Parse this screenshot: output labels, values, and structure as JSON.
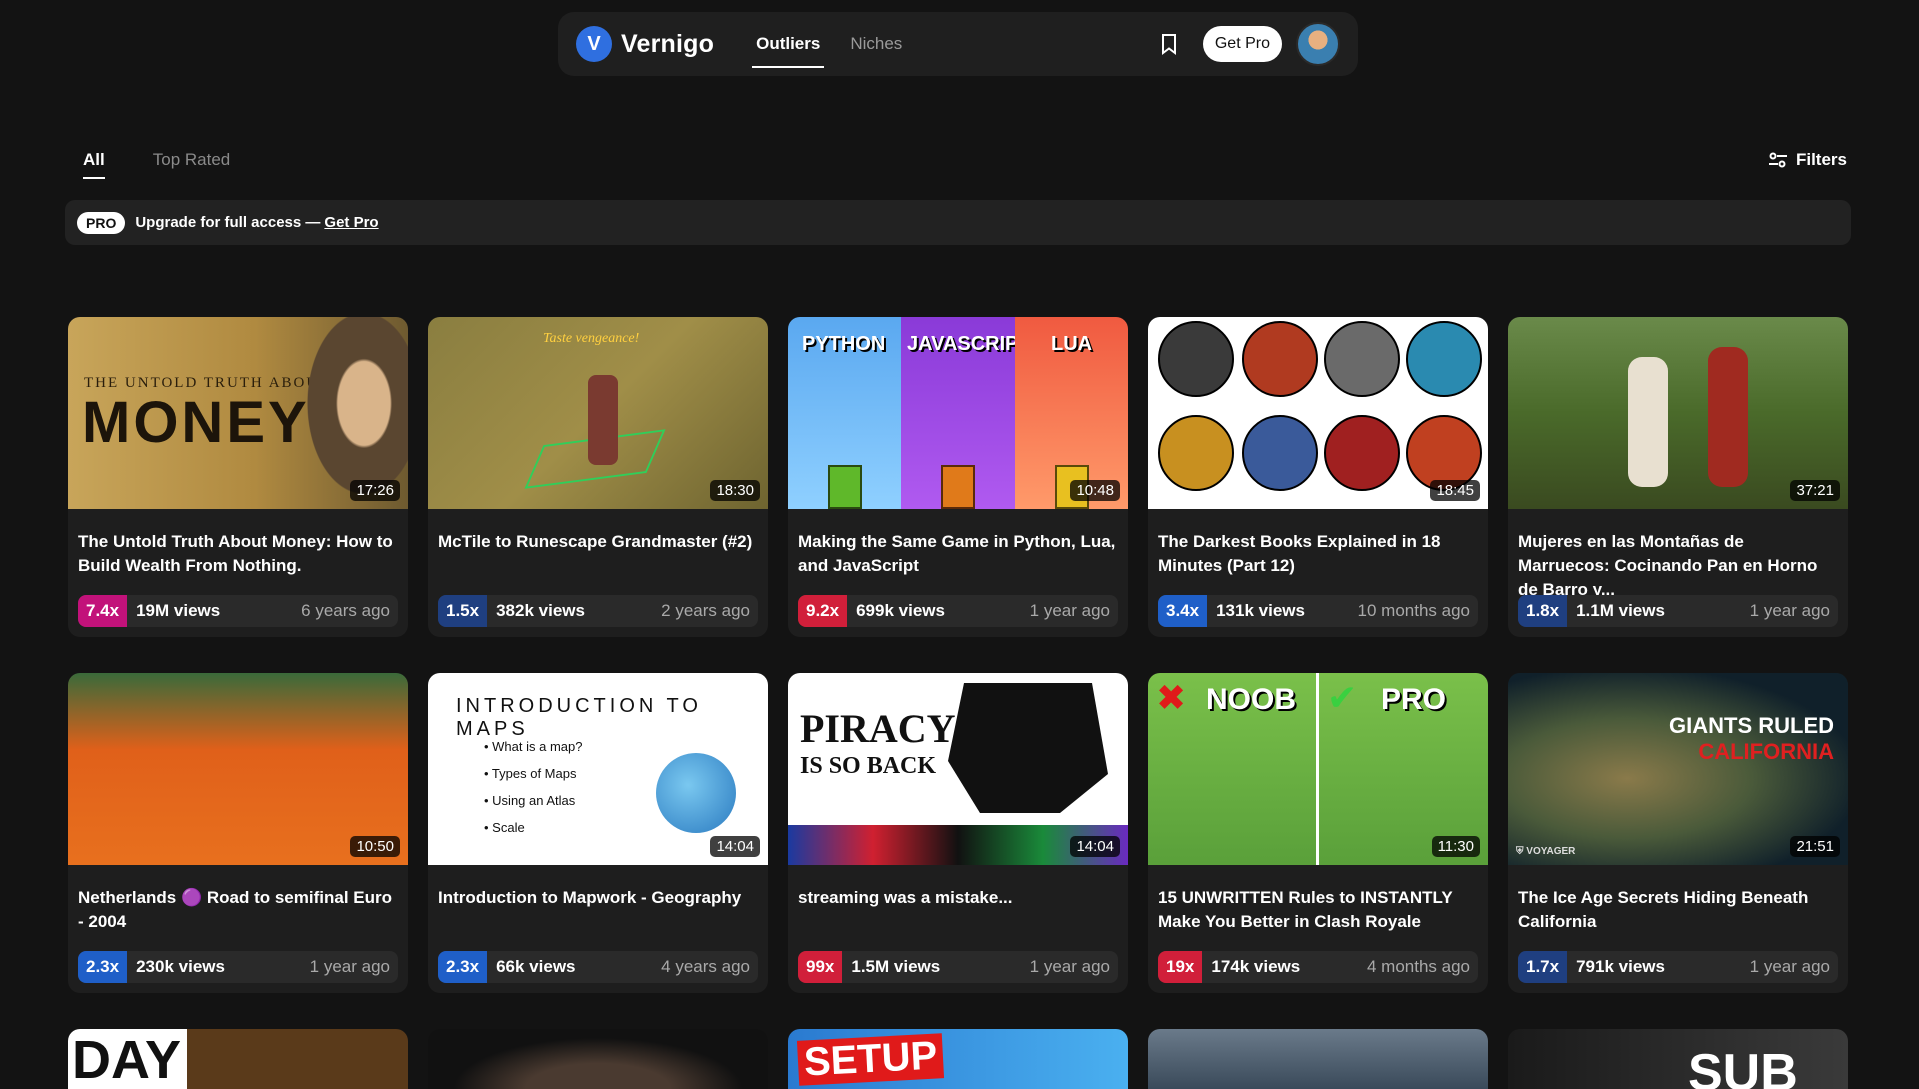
{
  "nav": {
    "logo_letter": "V",
    "brand": "Vernigo",
    "links": [
      {
        "label": "Outliers"
      },
      {
        "label": "Niches"
      }
    ],
    "get_pro": "Get Pro"
  },
  "tabs": [
    {
      "label": "All"
    },
    {
      "label": "Top Rated"
    }
  ],
  "filters_label": "Filters",
  "banner": {
    "badge": "PRO",
    "text": "Upgrade for full access —",
    "link": "Get Pro"
  },
  "colors": {
    "red": "#d11f3a",
    "blue": "#1f5fc8",
    "magenta": "#c2127a"
  },
  "videos": [
    {
      "title": "The Untold Truth About Money: How to Build Wealth From Nothing.",
      "duration": "17:26",
      "multiplier": "7.4x",
      "views": "19M views",
      "age": "6 years ago",
      "mult_color": "#c2127a",
      "thumb_text": "THE UNTOLD TRUTH ABOUT",
      "thumb_big": "MONEY"
    },
    {
      "title": "McTile to Runescape Grandmaster (#2)",
      "duration": "18:30",
      "multiplier": "1.5x",
      "views": "382k views",
      "age": "2 years ago",
      "mult_color": "#1f3f80",
      "thumb_text": "Taste vengeance!",
      "thumb_big": ""
    },
    {
      "title": "Making the Same Game in Python, Lua, and JavaScript",
      "duration": "10:48",
      "multiplier": "9.2x",
      "views": "699k views",
      "age": "1 year ago",
      "mult_color": "#d11f3a",
      "thumb_text": "PYTHON",
      "thumb_big": "JAVASCRIPT|LUA"
    },
    {
      "title": "The Darkest Books Explained in 18 Minutes (Part 12)",
      "duration": "18:45",
      "multiplier": "3.4x",
      "views": "131k views",
      "age": "10 months ago",
      "mult_color": "#1f5fc8",
      "thumb_text": "",
      "thumb_big": ""
    },
    {
      "title": "Mujeres en las Montañas de Marruecos: Cocinando Pan en Horno de Barro y...",
      "duration": "37:21",
      "multiplier": "1.8x",
      "views": "1.1M views",
      "age": "1 year ago",
      "mult_color": "#1f3f80",
      "thumb_text": "",
      "thumb_big": ""
    },
    {
      "title": "Netherlands 🟣 Road to semifinal Euro - 2004",
      "duration": "10:50",
      "multiplier": "2.3x",
      "views": "230k views",
      "age": "1 year ago",
      "mult_color": "#1f5fc8",
      "thumb_text": "",
      "thumb_big": ""
    },
    {
      "title": "Introduction to Mapwork - Geography",
      "duration": "14:04",
      "multiplier": "2.3x",
      "views": "66k views",
      "age": "4 years ago",
      "mult_color": "#1f5fc8",
      "thumb_text": "INTRODUCTION TO MAPS",
      "thumb_big": ""
    },
    {
      "title": "streaming was a mistake...",
      "duration": "14:04",
      "multiplier": "99x",
      "views": "1.5M views",
      "age": "1 year ago",
      "mult_color": "#d11f3a",
      "thumb_text": "PIRACY",
      "thumb_big": "IS SO BACK"
    },
    {
      "title": "15 UNWRITTEN Rules to INSTANTLY Make You Better in Clash Royale",
      "duration": "11:30",
      "multiplier": "19x",
      "views": "174k views",
      "age": "4 months ago",
      "mult_color": "#d11f3a",
      "thumb_text": "NOOB",
      "thumb_big": "PRO"
    },
    {
      "title": "The Ice Age Secrets Hiding Beneath California",
      "duration": "21:51",
      "multiplier": "1.7x",
      "views": "791k views",
      "age": "1 year ago",
      "mult_color": "#1f3f80",
      "thumb_text": "GIANTS RULED",
      "thumb_big": "CALIFORNIA"
    }
  ],
  "partial_texts": [
    "DAY",
    "SETUP",
    "SUB"
  ]
}
